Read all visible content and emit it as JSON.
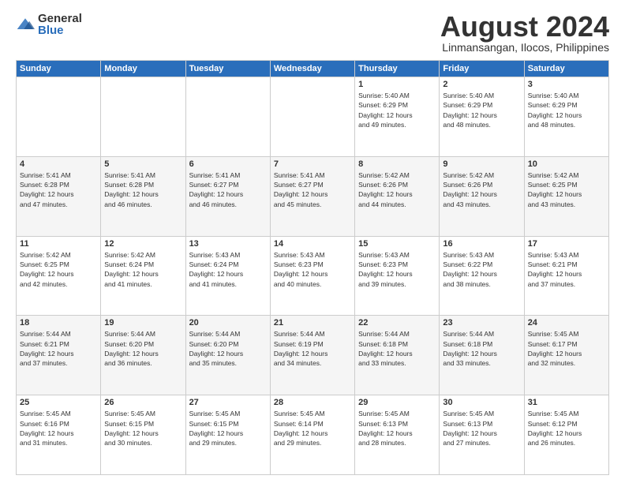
{
  "logo": {
    "general": "General",
    "blue": "Blue"
  },
  "header": {
    "month": "August 2024",
    "location": "Linmansangan, Ilocos, Philippines"
  },
  "weekdays": [
    "Sunday",
    "Monday",
    "Tuesday",
    "Wednesday",
    "Thursday",
    "Friday",
    "Saturday"
  ],
  "weeks": [
    [
      {
        "day": "",
        "info": ""
      },
      {
        "day": "",
        "info": ""
      },
      {
        "day": "",
        "info": ""
      },
      {
        "day": "",
        "info": ""
      },
      {
        "day": "1",
        "info": "Sunrise: 5:40 AM\nSunset: 6:29 PM\nDaylight: 12 hours\nand 49 minutes."
      },
      {
        "day": "2",
        "info": "Sunrise: 5:40 AM\nSunset: 6:29 PM\nDaylight: 12 hours\nand 48 minutes."
      },
      {
        "day": "3",
        "info": "Sunrise: 5:40 AM\nSunset: 6:29 PM\nDaylight: 12 hours\nand 48 minutes."
      }
    ],
    [
      {
        "day": "4",
        "info": "Sunrise: 5:41 AM\nSunset: 6:28 PM\nDaylight: 12 hours\nand 47 minutes."
      },
      {
        "day": "5",
        "info": "Sunrise: 5:41 AM\nSunset: 6:28 PM\nDaylight: 12 hours\nand 46 minutes."
      },
      {
        "day": "6",
        "info": "Sunrise: 5:41 AM\nSunset: 6:27 PM\nDaylight: 12 hours\nand 46 minutes."
      },
      {
        "day": "7",
        "info": "Sunrise: 5:41 AM\nSunset: 6:27 PM\nDaylight: 12 hours\nand 45 minutes."
      },
      {
        "day": "8",
        "info": "Sunrise: 5:42 AM\nSunset: 6:26 PM\nDaylight: 12 hours\nand 44 minutes."
      },
      {
        "day": "9",
        "info": "Sunrise: 5:42 AM\nSunset: 6:26 PM\nDaylight: 12 hours\nand 43 minutes."
      },
      {
        "day": "10",
        "info": "Sunrise: 5:42 AM\nSunset: 6:25 PM\nDaylight: 12 hours\nand 43 minutes."
      }
    ],
    [
      {
        "day": "11",
        "info": "Sunrise: 5:42 AM\nSunset: 6:25 PM\nDaylight: 12 hours\nand 42 minutes."
      },
      {
        "day": "12",
        "info": "Sunrise: 5:42 AM\nSunset: 6:24 PM\nDaylight: 12 hours\nand 41 minutes."
      },
      {
        "day": "13",
        "info": "Sunrise: 5:43 AM\nSunset: 6:24 PM\nDaylight: 12 hours\nand 41 minutes."
      },
      {
        "day": "14",
        "info": "Sunrise: 5:43 AM\nSunset: 6:23 PM\nDaylight: 12 hours\nand 40 minutes."
      },
      {
        "day": "15",
        "info": "Sunrise: 5:43 AM\nSunset: 6:23 PM\nDaylight: 12 hours\nand 39 minutes."
      },
      {
        "day": "16",
        "info": "Sunrise: 5:43 AM\nSunset: 6:22 PM\nDaylight: 12 hours\nand 38 minutes."
      },
      {
        "day": "17",
        "info": "Sunrise: 5:43 AM\nSunset: 6:21 PM\nDaylight: 12 hours\nand 37 minutes."
      }
    ],
    [
      {
        "day": "18",
        "info": "Sunrise: 5:44 AM\nSunset: 6:21 PM\nDaylight: 12 hours\nand 37 minutes."
      },
      {
        "day": "19",
        "info": "Sunrise: 5:44 AM\nSunset: 6:20 PM\nDaylight: 12 hours\nand 36 minutes."
      },
      {
        "day": "20",
        "info": "Sunrise: 5:44 AM\nSunset: 6:20 PM\nDaylight: 12 hours\nand 35 minutes."
      },
      {
        "day": "21",
        "info": "Sunrise: 5:44 AM\nSunset: 6:19 PM\nDaylight: 12 hours\nand 34 minutes."
      },
      {
        "day": "22",
        "info": "Sunrise: 5:44 AM\nSunset: 6:18 PM\nDaylight: 12 hours\nand 33 minutes."
      },
      {
        "day": "23",
        "info": "Sunrise: 5:44 AM\nSunset: 6:18 PM\nDaylight: 12 hours\nand 33 minutes."
      },
      {
        "day": "24",
        "info": "Sunrise: 5:45 AM\nSunset: 6:17 PM\nDaylight: 12 hours\nand 32 minutes."
      }
    ],
    [
      {
        "day": "25",
        "info": "Sunrise: 5:45 AM\nSunset: 6:16 PM\nDaylight: 12 hours\nand 31 minutes."
      },
      {
        "day": "26",
        "info": "Sunrise: 5:45 AM\nSunset: 6:15 PM\nDaylight: 12 hours\nand 30 minutes."
      },
      {
        "day": "27",
        "info": "Sunrise: 5:45 AM\nSunset: 6:15 PM\nDaylight: 12 hours\nand 29 minutes."
      },
      {
        "day": "28",
        "info": "Sunrise: 5:45 AM\nSunset: 6:14 PM\nDaylight: 12 hours\nand 29 minutes."
      },
      {
        "day": "29",
        "info": "Sunrise: 5:45 AM\nSunset: 6:13 PM\nDaylight: 12 hours\nand 28 minutes."
      },
      {
        "day": "30",
        "info": "Sunrise: 5:45 AM\nSunset: 6:13 PM\nDaylight: 12 hours\nand 27 minutes."
      },
      {
        "day": "31",
        "info": "Sunrise: 5:45 AM\nSunset: 6:12 PM\nDaylight: 12 hours\nand 26 minutes."
      }
    ]
  ]
}
